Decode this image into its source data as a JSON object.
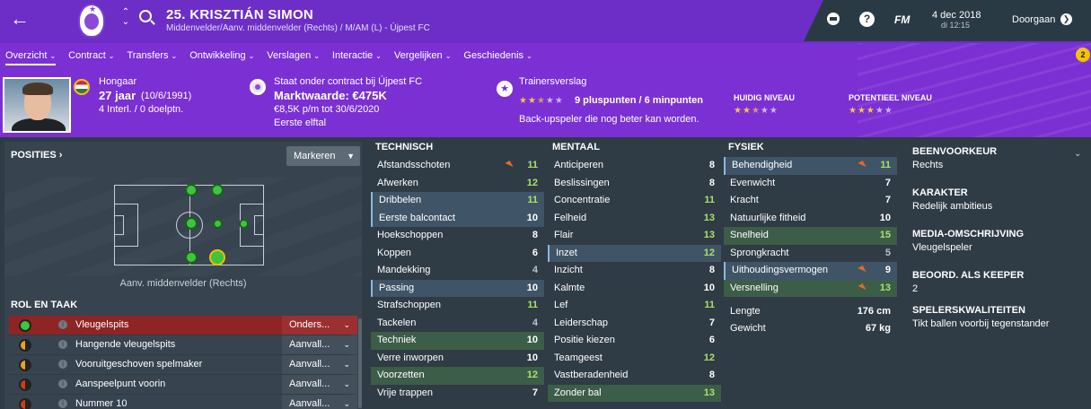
{
  "header": {
    "player_title": "25. KRISZTIÁN SIMON",
    "player_subtitle": "Middenvelder/Aanv. middenvelder (Rechts) / M/AM (L) - Újpest FC",
    "date": "4 dec 2018",
    "time": "di 12:15",
    "fm_label": "FM",
    "continue_label": "Doorgaan",
    "help_label": "?",
    "nav_up": "⌃",
    "nav_down": "⌄"
  },
  "tabs": [
    {
      "label": "Overzicht"
    },
    {
      "label": "Contract"
    },
    {
      "label": "Transfers"
    },
    {
      "label": "Ontwikkeling"
    },
    {
      "label": "Verslagen"
    },
    {
      "label": "Interactie"
    },
    {
      "label": "Vergelijken"
    },
    {
      "label": "Geschiedenis"
    }
  ],
  "notification_count": "2",
  "profile": {
    "nationality": "Hongaar",
    "age": "27 jaar",
    "dob": "(10/6/1991)",
    "caps": "4 Interl. / 0 doelptn.",
    "contract_status": "Staat onder contract bij Újpest FC",
    "market_value": "Marktwaarde: €475K",
    "wage": "€8,5K p/m tot 30/6/2020",
    "squad": "Eerste elftal",
    "scout_title": "Trainersverslag",
    "scout_points": "9 pluspunten / 6 minpunten",
    "scout_summary": "Back-upspeler die nog beter kan worden.",
    "scout_stars": 2.5,
    "current_level_label": "HUIDIG NIVEAU",
    "current_level_stars": 2.5,
    "potential_level_label": "POTENTIEEL NIVEAU",
    "potential_level_stars": 3
  },
  "positions": {
    "title": "POSITIES",
    "mark_button": "Markeren",
    "caption": "Aanv. middenvelder (Rechts)"
  },
  "roles": {
    "title": "ROL EN TAAK",
    "items": [
      {
        "name": "Vleugelspits",
        "duty": "Onders...",
        "colors": [
          "#3ec43e",
          "#3ec43e"
        ]
      },
      {
        "name": "Hangende vleugelspits",
        "duty": "Aanvall...",
        "colors": [
          "#e8a420",
          "#222222"
        ]
      },
      {
        "name": "Vooruitgeschoven spelmaker",
        "duty": "Aanvall...",
        "colors": [
          "#e8a420",
          "#222222"
        ]
      },
      {
        "name": "Aanspeelpunt voorin",
        "duty": "Aanvall...",
        "colors": [
          "#d03a1a",
          "#222222"
        ]
      },
      {
        "name": "Nummer 10",
        "duty": "Aanvall...",
        "colors": [
          "#d03a1a",
          "#222222"
        ]
      }
    ]
  },
  "technical": {
    "title": "TECHNISCH",
    "rows": [
      {
        "name": "Afstandsschoten",
        "value": "11"
      },
      {
        "name": "Afwerken",
        "value": "12"
      },
      {
        "name": "Dribbelen",
        "value": "11"
      },
      {
        "name": "Eerste balcontact",
        "value": "10"
      },
      {
        "name": "Hoekschoppen",
        "value": "8"
      },
      {
        "name": "Koppen",
        "value": "6"
      },
      {
        "name": "Mandekking",
        "value": "4"
      },
      {
        "name": "Passing",
        "value": "10"
      },
      {
        "name": "Strafschoppen",
        "value": "11"
      },
      {
        "name": "Tackelen",
        "value": "4"
      },
      {
        "name": "Techniek",
        "value": "10"
      },
      {
        "name": "Verre inworpen",
        "value": "10"
      },
      {
        "name": "Voorzetten",
        "value": "12"
      },
      {
        "name": "Vrije trappen",
        "value": "7"
      }
    ]
  },
  "mental": {
    "title": "MENTAAL",
    "rows": [
      {
        "name": "Anticiperen",
        "value": "8"
      },
      {
        "name": "Beslissingen",
        "value": "8"
      },
      {
        "name": "Concentratie",
        "value": "11"
      },
      {
        "name": "Felheid",
        "value": "13"
      },
      {
        "name": "Flair",
        "value": "13"
      },
      {
        "name": "Inzet",
        "value": "12"
      },
      {
        "name": "Inzicht",
        "value": "8"
      },
      {
        "name": "Kalmte",
        "value": "10"
      },
      {
        "name": "Lef",
        "value": "11"
      },
      {
        "name": "Leiderschap",
        "value": "7"
      },
      {
        "name": "Positie kiezen",
        "value": "6"
      },
      {
        "name": "Teamgeest",
        "value": "12"
      },
      {
        "name": "Vastberadenheid",
        "value": "8"
      },
      {
        "name": "Zonder bal",
        "value": "13"
      }
    ]
  },
  "physical": {
    "title": "FYSIEK",
    "rows": [
      {
        "name": "Behendigheid",
        "value": "11"
      },
      {
        "name": "Evenwicht",
        "value": "7"
      },
      {
        "name": "Kracht",
        "value": "7"
      },
      {
        "name": "Natuurlijke fitheid",
        "value": "10"
      },
      {
        "name": "Snelheid",
        "value": "15"
      },
      {
        "name": "Sprongkracht",
        "value": "5"
      },
      {
        "name": "Uithoudingsvermogen",
        "value": "9"
      },
      {
        "name": "Versnelling",
        "value": "13"
      }
    ],
    "height_label": "Lengte",
    "height": "176 cm",
    "weight_label": "Gewicht",
    "weight": "67 kg"
  },
  "side": {
    "foot_label": "BEENVOORKEUR",
    "foot": "Rechts",
    "character_label": "KARAKTER",
    "character": "Redelijk ambitieus",
    "media_label": "MEDIA-OMSCHRIJVING",
    "media": "Vleugelspeler",
    "keeper_label": "BEOORD. ALS KEEPER",
    "keeper": "2",
    "traits_label": "SPELERSKWALITEITEN",
    "traits": "Tikt ballen voorbij tegenstander"
  }
}
